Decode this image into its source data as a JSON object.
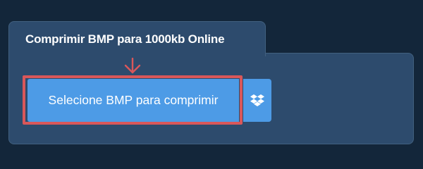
{
  "panel": {
    "title": "Comprimir BMP para 1000kb Online"
  },
  "upload": {
    "select_label": "Selecione BMP para comprimir",
    "dropbox_icon": "dropbox-icon",
    "pointer_icon": "arrow-down-icon"
  },
  "colors": {
    "page_background": "#13263a",
    "panel_background": "#2d4b6d",
    "button_blue": "#4d9be6",
    "highlight_red": "#d9575a"
  }
}
